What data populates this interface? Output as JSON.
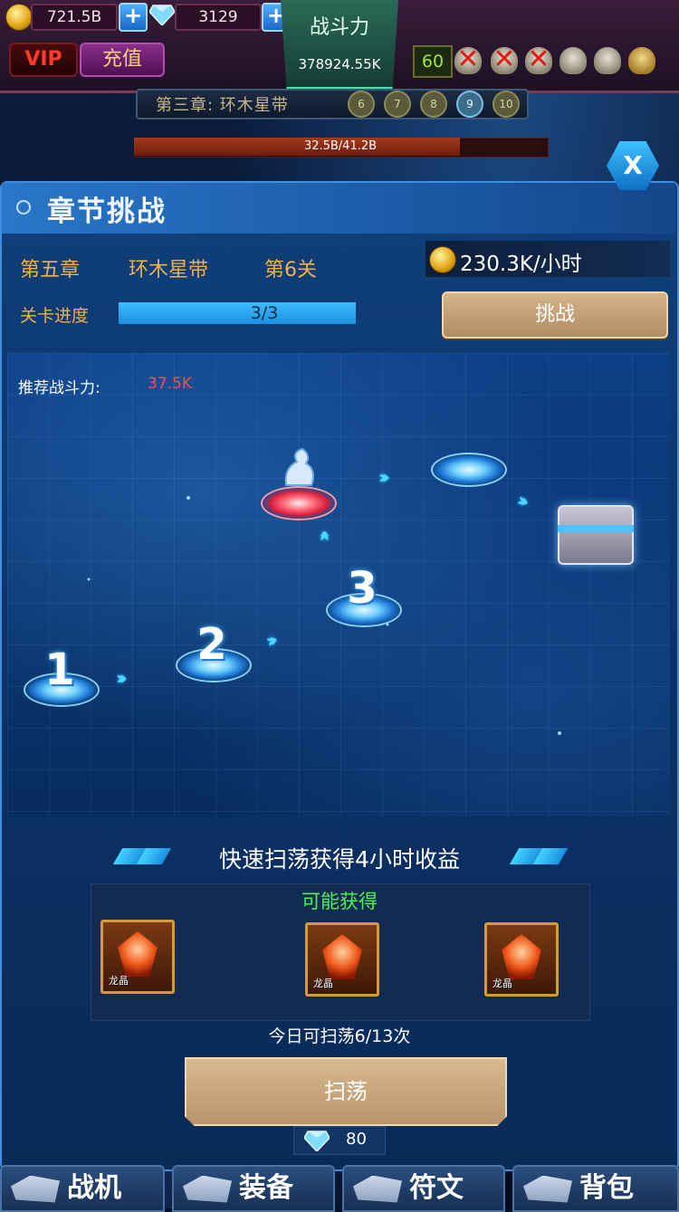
{
  "hud": {
    "gold": "721.5B",
    "gems": "3129",
    "vip_label": "VIP",
    "recharge_label": "充值",
    "power_label": "战斗力",
    "power_value": "378924.55K",
    "stage_level": "60",
    "chapter_name": "第三章: 环木星带",
    "chapter_levels": [
      "6",
      "7",
      "8",
      "9",
      "10"
    ],
    "current_level_index": 3,
    "boss_hp_text": "32.5B/41.2B",
    "boss_hp_fraction": 0.79,
    "close_label": "X"
  },
  "panel": {
    "title": "章节挑战",
    "chapter": "第五章",
    "chapter_name": "环木星带",
    "stage": "第6关",
    "rate": "230.3K/小时",
    "progress_label": "关卡进度",
    "progress_text": "3/3",
    "progress_fraction": 1.0,
    "challenge_label": "挑战"
  },
  "map": {
    "recommend_label": "推荐战斗力:",
    "recommend_value": "37.5K",
    "nodes": [
      "1",
      "2",
      "3"
    ]
  },
  "sweep": {
    "title": "快速扫荡获得4小时收益",
    "rewards_label": "可能获得",
    "items": [
      {
        "name": "龙晶",
        "icon": "dragon-crystal-icon"
      },
      {
        "name": "龙晶",
        "icon": "dragon-crystal-icon"
      },
      {
        "name": "龙晶",
        "icon": "dragon-crystal-icon"
      }
    ],
    "count_text": "今日可扫荡6/13次",
    "button_label": "扫荡",
    "cost": "80"
  },
  "nav": {
    "tabs": [
      "战机",
      "装备",
      "符文",
      "背包"
    ]
  },
  "colors": {
    "accent": "#3ec2ff",
    "gold_text": "#f2b04a",
    "warning_red": "#ff4a4a",
    "reward_green": "#4cf05a"
  }
}
